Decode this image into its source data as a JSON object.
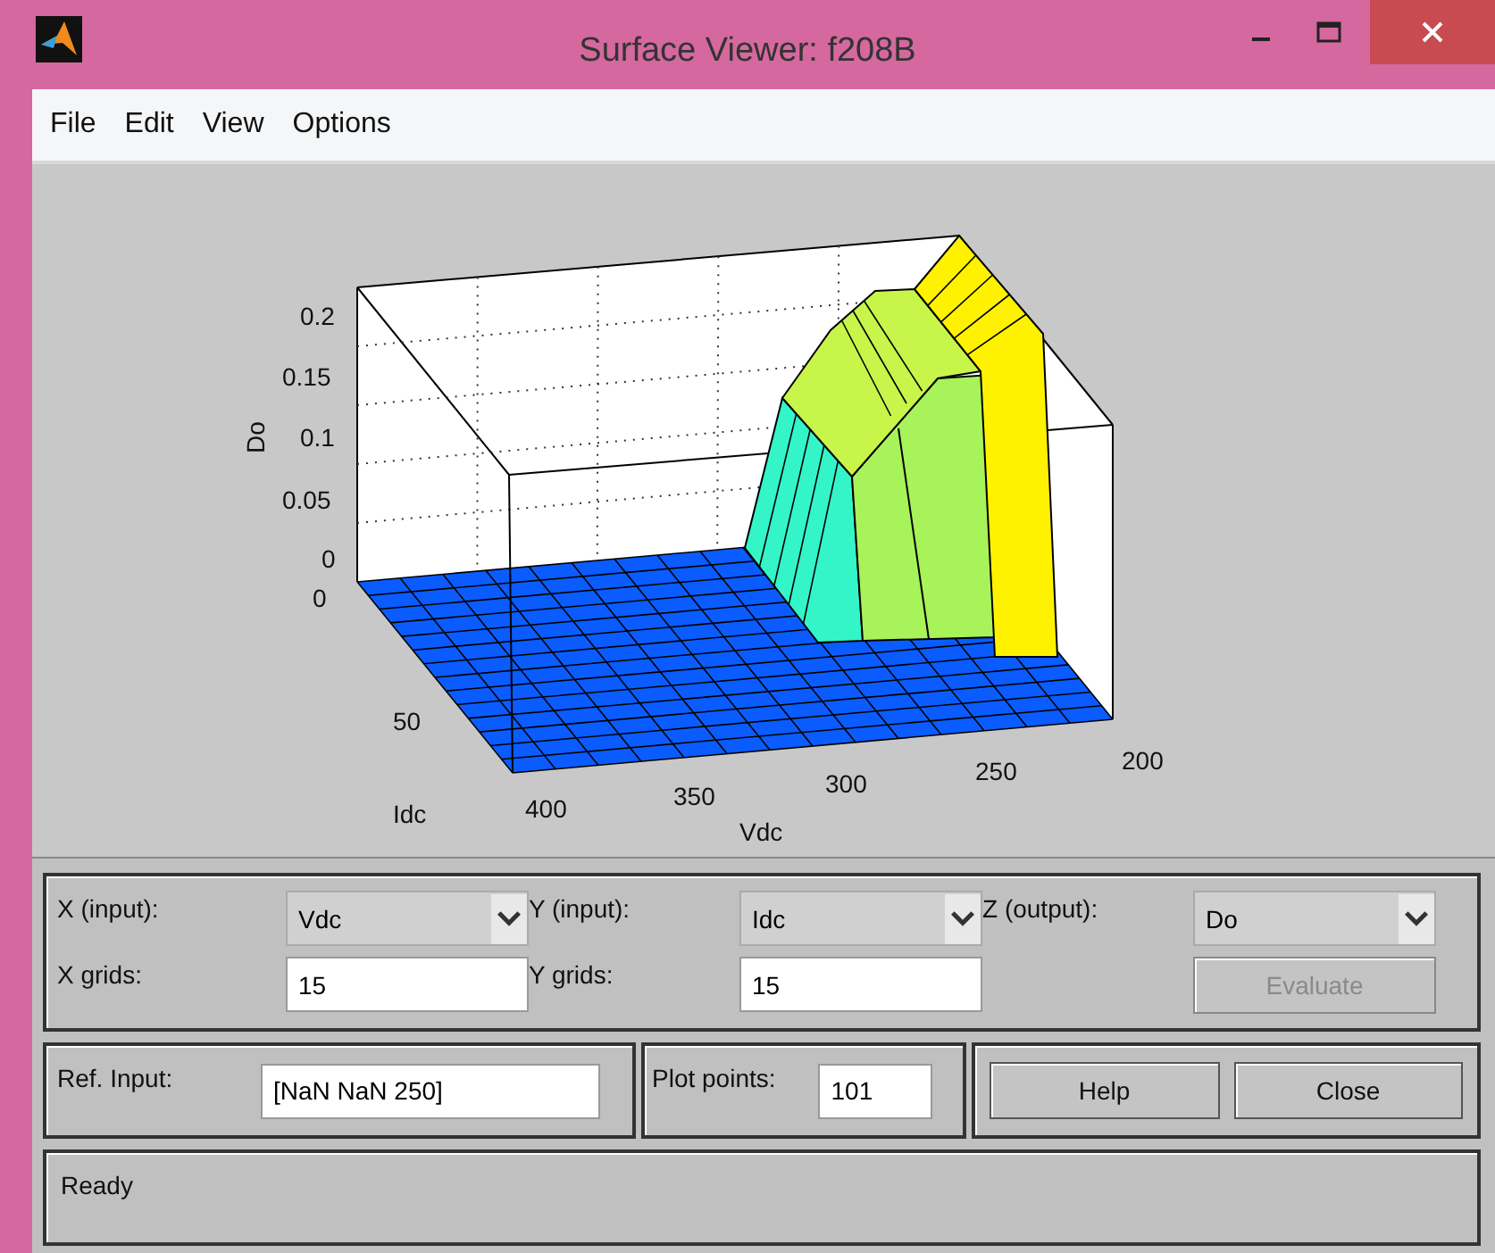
{
  "window": {
    "title": "Surface Viewer: f208B"
  },
  "menu": [
    "File",
    "Edit",
    "View",
    "Options"
  ],
  "plot": {
    "zlabel": "Do",
    "ylabel": "Idc",
    "xlabel": "Vdc",
    "zticks": [
      "0.2",
      "0.15",
      "0.1",
      "0.05",
      "0"
    ],
    "yticks": [
      "0",
      "50"
    ],
    "xticks": [
      "400",
      "350",
      "300",
      "250",
      "200"
    ]
  },
  "axes": [
    {
      "label": "X (input):",
      "value": "Vdc"
    },
    {
      "label": "Y (input):",
      "value": "Idc"
    },
    {
      "label": "Z (output):",
      "value": "Do"
    }
  ],
  "grids": [
    {
      "label": "X grids:",
      "value": "15"
    },
    {
      "label": "Y grids:",
      "value": "15"
    }
  ],
  "evaluate": {
    "label": "Evaluate",
    "disabled": true
  },
  "ref_input": {
    "label": "Ref. Input:",
    "value": "[NaN NaN 250]"
  },
  "plot_points": {
    "label": "Plot points:",
    "value": "101"
  },
  "buttons": [
    "Help",
    "Close"
  ],
  "status": "Ready"
}
